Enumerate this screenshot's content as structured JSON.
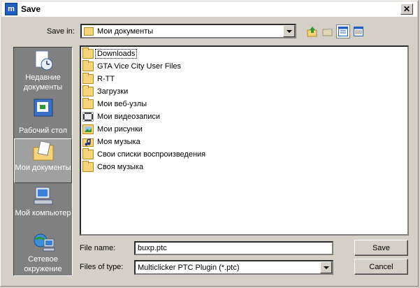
{
  "window": {
    "title": "Save",
    "app_icon_letter": "m"
  },
  "save_in": {
    "label": "Save in:",
    "value": "Мои документы"
  },
  "toolbar": {
    "icons": [
      "up-folder-icon",
      "new-folder-icon",
      "view-list-icon",
      "view-details-icon"
    ]
  },
  "places": [
    {
      "label": "Недавние документы",
      "icon": "recent-documents-icon",
      "selected": false
    },
    {
      "label": "Рабочий стол",
      "icon": "desktop-icon",
      "selected": false
    },
    {
      "label": "Мои документы",
      "icon": "my-documents-icon",
      "selected": true
    },
    {
      "label": "Мой компьютер",
      "icon": "my-computer-icon",
      "selected": false
    },
    {
      "label": "Сетевое окружение",
      "icon": "network-places-icon",
      "selected": false
    }
  ],
  "files": [
    {
      "name": "Downloads",
      "icon": "folder-icon"
    },
    {
      "name": "GTA Vice City User Files",
      "icon": "folder-icon"
    },
    {
      "name": "R-TT",
      "icon": "folder-icon"
    },
    {
      "name": "Загрузки",
      "icon": "folder-icon"
    },
    {
      "name": "Мои веб-узлы",
      "icon": "folder-icon"
    },
    {
      "name": "Мои видеозаписи",
      "icon": "video-folder-icon"
    },
    {
      "name": "Мои рисунки",
      "icon": "pictures-folder-icon"
    },
    {
      "name": "Моя музыка",
      "icon": "music-folder-icon"
    },
    {
      "name": "Свои списки воспроизведения",
      "icon": "folder-icon"
    },
    {
      "name": "Своя музыка",
      "icon": "folder-icon"
    }
  ],
  "filename": {
    "label": "File name:",
    "value": "buxp.ptc"
  },
  "filetype": {
    "label": "Files of type:",
    "value": "Multiclicker PTC Plugin (*.ptc)"
  },
  "buttons": {
    "save": "Save",
    "cancel": "Cancel"
  }
}
